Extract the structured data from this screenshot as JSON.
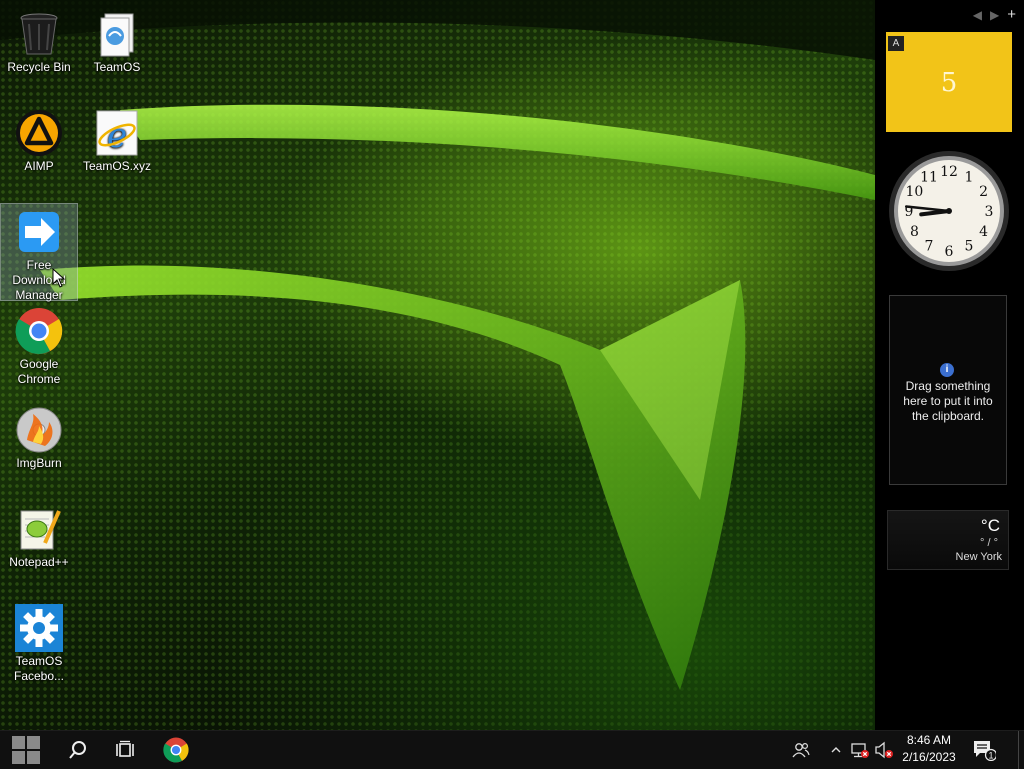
{
  "desktop": {
    "icons": [
      {
        "label": "Recycle Bin",
        "icon": "recycle-bin-icon"
      },
      {
        "label": "TeamOS",
        "icon": "teamos-folder-icon"
      },
      {
        "label": "AIMP",
        "icon": "aimp-icon"
      },
      {
        "label": "TeamOS.xyz",
        "icon": "internet-explorer-icon"
      },
      {
        "label": "Free Download Manager",
        "icon": "free-download-manager-icon"
      },
      {
        "label": "Google Chrome",
        "icon": "google-chrome-icon"
      },
      {
        "label": "ImgBurn",
        "icon": "imgburn-icon"
      },
      {
        "label": "Notepad++",
        "icon": "notepad-plus-plus-icon"
      },
      {
        "label": "TeamOS Facebo...",
        "icon": "gear-icon"
      }
    ],
    "selected_icon": "Free Download Manager"
  },
  "sidebar": {
    "controls": {
      "prev": "◀",
      "next": "▶",
      "add": "+"
    },
    "calendar": {
      "badge": "A",
      "day": "5",
      "color": "#f2c418"
    },
    "clock": {
      "hour": 8,
      "minute": 46
    },
    "clipboard": {
      "info_glyph": "i",
      "text": "Drag something here to put it into the clipboard."
    },
    "weather": {
      "temp": "°C",
      "range": "° / °",
      "city": "New York"
    }
  },
  "taskbar": {
    "buttons": [
      "start-button",
      "search-button",
      "task-view-button",
      "chrome-pinned-button"
    ],
    "tray": {
      "time": "8:46 AM",
      "date": "2/16/2023",
      "notification_count": "1",
      "icons": [
        "people-icon",
        "chevron-up-icon",
        "network-disconnected-icon",
        "volume-muted-icon"
      ]
    }
  }
}
